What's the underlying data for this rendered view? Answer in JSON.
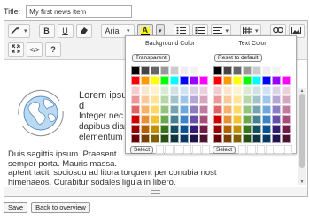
{
  "title_field": {
    "label": "Title:",
    "value": "My first news item"
  },
  "toolbar": {
    "bold": "B",
    "underline": "U",
    "font_family": "Arial",
    "font_color_letter": "A",
    "html_button": "</>",
    "help_button": "?"
  },
  "content": {
    "paragraph1": [
      "Lorem ipsum d",
      "Integer nec odi",
      "dapibus diam.",
      "elementum imp"
    ],
    "paragraph2": [
      "Duis sagittis ipsum. Praesent",
      "semper porta. Mauris massa.",
      "aptent taciti sociosqu ad litora torquent per conubia nostra, per inceptos",
      "himenaeos. Curabitur sodales ligula in libero."
    ]
  },
  "color_popup": {
    "background": {
      "title": "Background Color",
      "reset_label": "Transparent",
      "select_label": "Select"
    },
    "text": {
      "title": "Text Color",
      "reset_label": "Reset to default",
      "select_label": "Select"
    },
    "palette": [
      [
        "#000000",
        "#444444",
        "#666666",
        "#999999",
        "#cccccc",
        "#eeeeee",
        "#f3f3f3",
        "#ffffff"
      ],
      [
        "#ff0000",
        "#ff9900",
        "#ffff00",
        "#00ff00",
        "#00ffff",
        "#0000ff",
        "#9900ff",
        "#ff00ff"
      ],
      [
        "#f4cccc",
        "#fce5cd",
        "#fff2cc",
        "#d9ead3",
        "#d0e0e3",
        "#cfe2f3",
        "#d9d2e9",
        "#ead1dc"
      ],
      [
        "#ea9999",
        "#f9cb9c",
        "#ffe599",
        "#b6d7a8",
        "#a2c4c9",
        "#9fc5e8",
        "#b4a7d6",
        "#d5a6bd"
      ],
      [
        "#e06666",
        "#f6b26b",
        "#ffd966",
        "#93c47d",
        "#76a5af",
        "#6fa8dc",
        "#8e7cc3",
        "#c27ba0"
      ],
      [
        "#cc0000",
        "#e69138",
        "#f1c232",
        "#6aa84f",
        "#45818e",
        "#3d85c6",
        "#674ea7",
        "#a64d79"
      ],
      [
        "#990000",
        "#b45f06",
        "#bf9000",
        "#38761d",
        "#134f5c",
        "#0b5394",
        "#351c75",
        "#741b47"
      ],
      [
        "#660000",
        "#783f04",
        "#7f6000",
        "#274e13",
        "#0c343d",
        "#073763",
        "#20124d",
        "#4c1130"
      ]
    ]
  },
  "bottom": {
    "save": "Save",
    "back": "Back to overview"
  }
}
